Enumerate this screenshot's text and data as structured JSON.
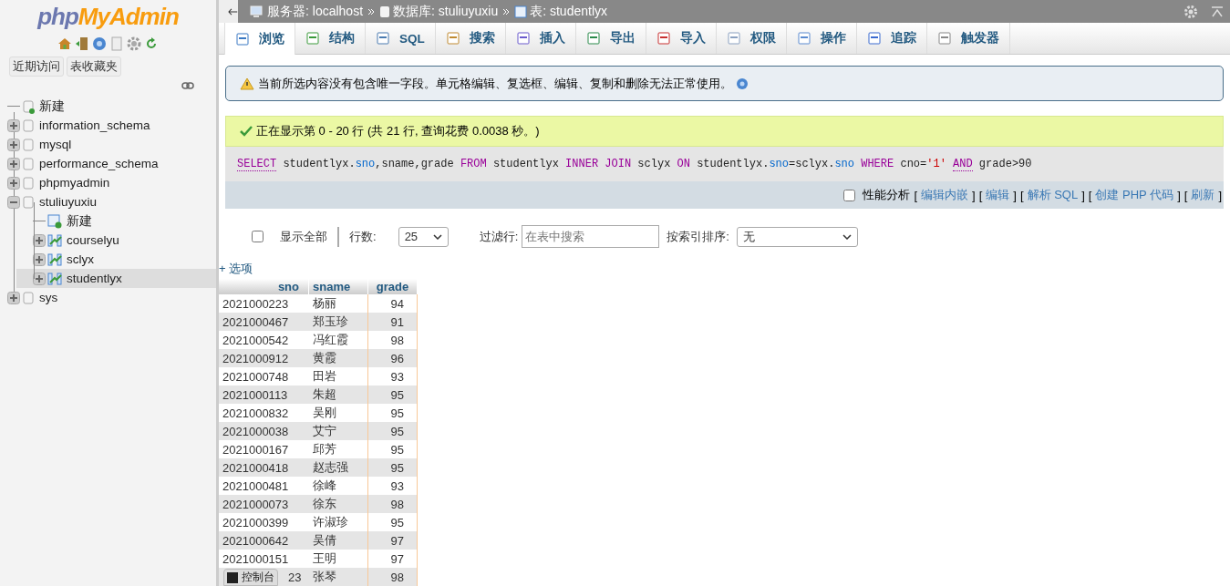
{
  "sidebar": {
    "logo": {
      "php": "php",
      "myadmin": "MyAdmin"
    },
    "buttons": [
      "近期访问",
      "表收藏夹"
    ],
    "tree": [
      {
        "label": "新建",
        "kind": "new"
      },
      {
        "label": "information_schema",
        "kind": "database",
        "expanded": false
      },
      {
        "label": "mysql",
        "kind": "database",
        "expanded": false
      },
      {
        "label": "performance_schema",
        "kind": "database",
        "expanded": false
      },
      {
        "label": "phpmyadmin",
        "kind": "database",
        "expanded": false
      },
      {
        "label": "stuliuyuxiu",
        "kind": "database",
        "expanded": true,
        "children": [
          {
            "label": "新建",
            "kind": "new-table",
            "selected": false
          },
          {
            "label": "courselyu",
            "kind": "table",
            "selected": false
          },
          {
            "label": "sclyx",
            "kind": "table",
            "selected": false
          },
          {
            "label": "studentlyx",
            "kind": "table",
            "selected": true
          }
        ]
      },
      {
        "label": "sys",
        "kind": "database",
        "expanded": false
      }
    ]
  },
  "breadcrumb": [
    {
      "kind": "server",
      "label": "服务器: localhost"
    },
    {
      "kind": "database",
      "label": "数据库: stuliuyuxiu"
    },
    {
      "kind": "table",
      "label": "表: studentlyx"
    }
  ],
  "tabs": [
    {
      "label": "浏览",
      "selected": true
    },
    {
      "label": "结构",
      "selected": false
    },
    {
      "label": "SQL",
      "selected": false
    },
    {
      "label": "搜索",
      "selected": false
    },
    {
      "label": "插入",
      "selected": false
    },
    {
      "label": "导出",
      "selected": false
    },
    {
      "label": "导入",
      "selected": false
    },
    {
      "label": "权限",
      "selected": false
    },
    {
      "label": "操作",
      "selected": false
    },
    {
      "label": "追踪",
      "selected": false
    },
    {
      "label": "触发器",
      "selected": false
    }
  ],
  "warning": "当前所选内容没有包含唯一字段。单元格编辑、复选框、编辑、复制和删除无法正常使用。",
  "success": "正在显示第 0 - 20 行 (共 21 行, 查询花费 0.0038 秒。)",
  "sql": [
    {
      "kind": "doc",
      "text": "SELECT"
    },
    {
      "kind": "plain",
      "text": " studentlyx."
    },
    {
      "kind": "column",
      "text": "sno"
    },
    {
      "kind": "plain",
      "text": ",sname,grade "
    },
    {
      "kind": "keyword",
      "text": "FROM"
    },
    {
      "kind": "plain",
      "text": " studentlyx "
    },
    {
      "kind": "keyword",
      "text": "INNER JOIN"
    },
    {
      "kind": "plain",
      "text": " sclyx "
    },
    {
      "kind": "keyword",
      "text": "ON"
    },
    {
      "kind": "plain",
      "text": " studentlyx."
    },
    {
      "kind": "column",
      "text": "sno"
    },
    {
      "kind": "plain",
      "text": "=sclyx."
    },
    {
      "kind": "column",
      "text": "sno "
    },
    {
      "kind": "keyword",
      "text": "WHERE"
    },
    {
      "kind": "plain",
      "text": " cno="
    },
    {
      "kind": "string",
      "text": "'1' "
    },
    {
      "kind": "doc",
      "text": "AND"
    },
    {
      "kind": "plain",
      "text": " grade>90"
    }
  ],
  "sql_links": {
    "profiling": {
      "label": "性能分析",
      "checked": false
    },
    "links": [
      {
        "open": "[",
        "label": "编辑内嵌",
        "close": "]"
      },
      {
        "open": "[",
        "label": "编辑",
        "close": "]"
      },
      {
        "open": "[",
        "label": "解析 SQL",
        "close": "]"
      },
      {
        "open": "[",
        "label": "创建 PHP 代码",
        "close": "]"
      },
      {
        "open": "[",
        "label": "刷新",
        "close": "]"
      }
    ]
  },
  "nav": {
    "show_all": {
      "label": "显示全部",
      "checked": false
    },
    "rows_label": "行数:",
    "rows_value": "25",
    "filter_label": "过滤行:",
    "filter_placeholder": "在表中搜索",
    "sort_label": "按索引排序:",
    "sort_value": "无"
  },
  "options_link": "+ 选项",
  "table": {
    "columns": [
      "sno",
      "sname",
      "grade"
    ],
    "rows": [
      [
        "2021000223",
        "杨丽",
        "94"
      ],
      [
        "2021000467",
        "郑玉珍",
        "91"
      ],
      [
        "2021000542",
        "冯红霞",
        "98"
      ],
      [
        "2021000912",
        "黄霞",
        "96"
      ],
      [
        "2021000748",
        "田岩",
        "93"
      ],
      [
        "2021000113",
        "朱超",
        "95"
      ],
      [
        "2021000832",
        "吴刚",
        "95"
      ],
      [
        "2021000038",
        "艾宁",
        "95"
      ],
      [
        "2021000167",
        "邱芳",
        "95"
      ],
      [
        "2021000418",
        "赵志强",
        "95"
      ],
      [
        "2021000481",
        "徐峰",
        "93"
      ],
      [
        "2021000073",
        "徐东",
        "98"
      ],
      [
        "2021000399",
        "许淑珍",
        "95"
      ],
      [
        "2021000642",
        "吴倩",
        "97"
      ],
      [
        "2021000151",
        "王明",
        "97"
      ],
      [
        "23",
        "张琴",
        "98"
      ]
    ]
  },
  "console": "控制台"
}
